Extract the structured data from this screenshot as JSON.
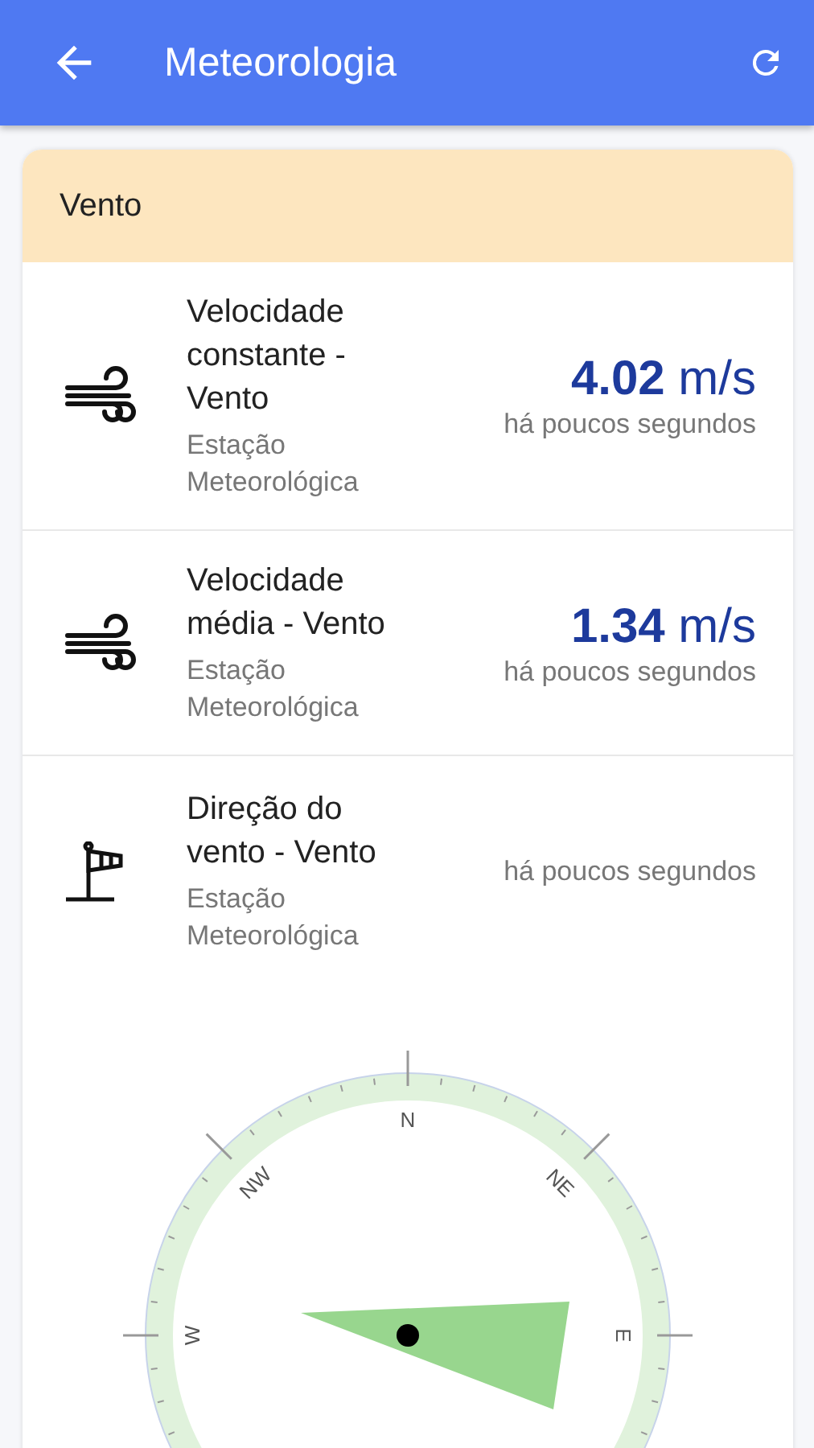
{
  "app_bar": {
    "title": "Meteorologia"
  },
  "card": {
    "title": "Vento",
    "sensors": [
      {
        "kind": "wind",
        "title": "Velocidade constante - Vento",
        "source": "Estação Meteorológica",
        "value": "**4.02** m/s",
        "time": "há poucos segundos"
      },
      {
        "kind": "wind",
        "title": "Velocidade média - Vento",
        "source": "Estação Meteorológica",
        "value": "**1.34** m/s",
        "time": "há poucos segundos"
      },
      {
        "kind": "windsock",
        "title": "Direção do vento - Vento",
        "source": "Estação Meteorológica",
        "time": "há poucos segundos"
      }
    ],
    "compass": {
      "labels": [
        "N",
        "NE",
        "E",
        "W",
        "NW"
      ]
    }
  }
}
